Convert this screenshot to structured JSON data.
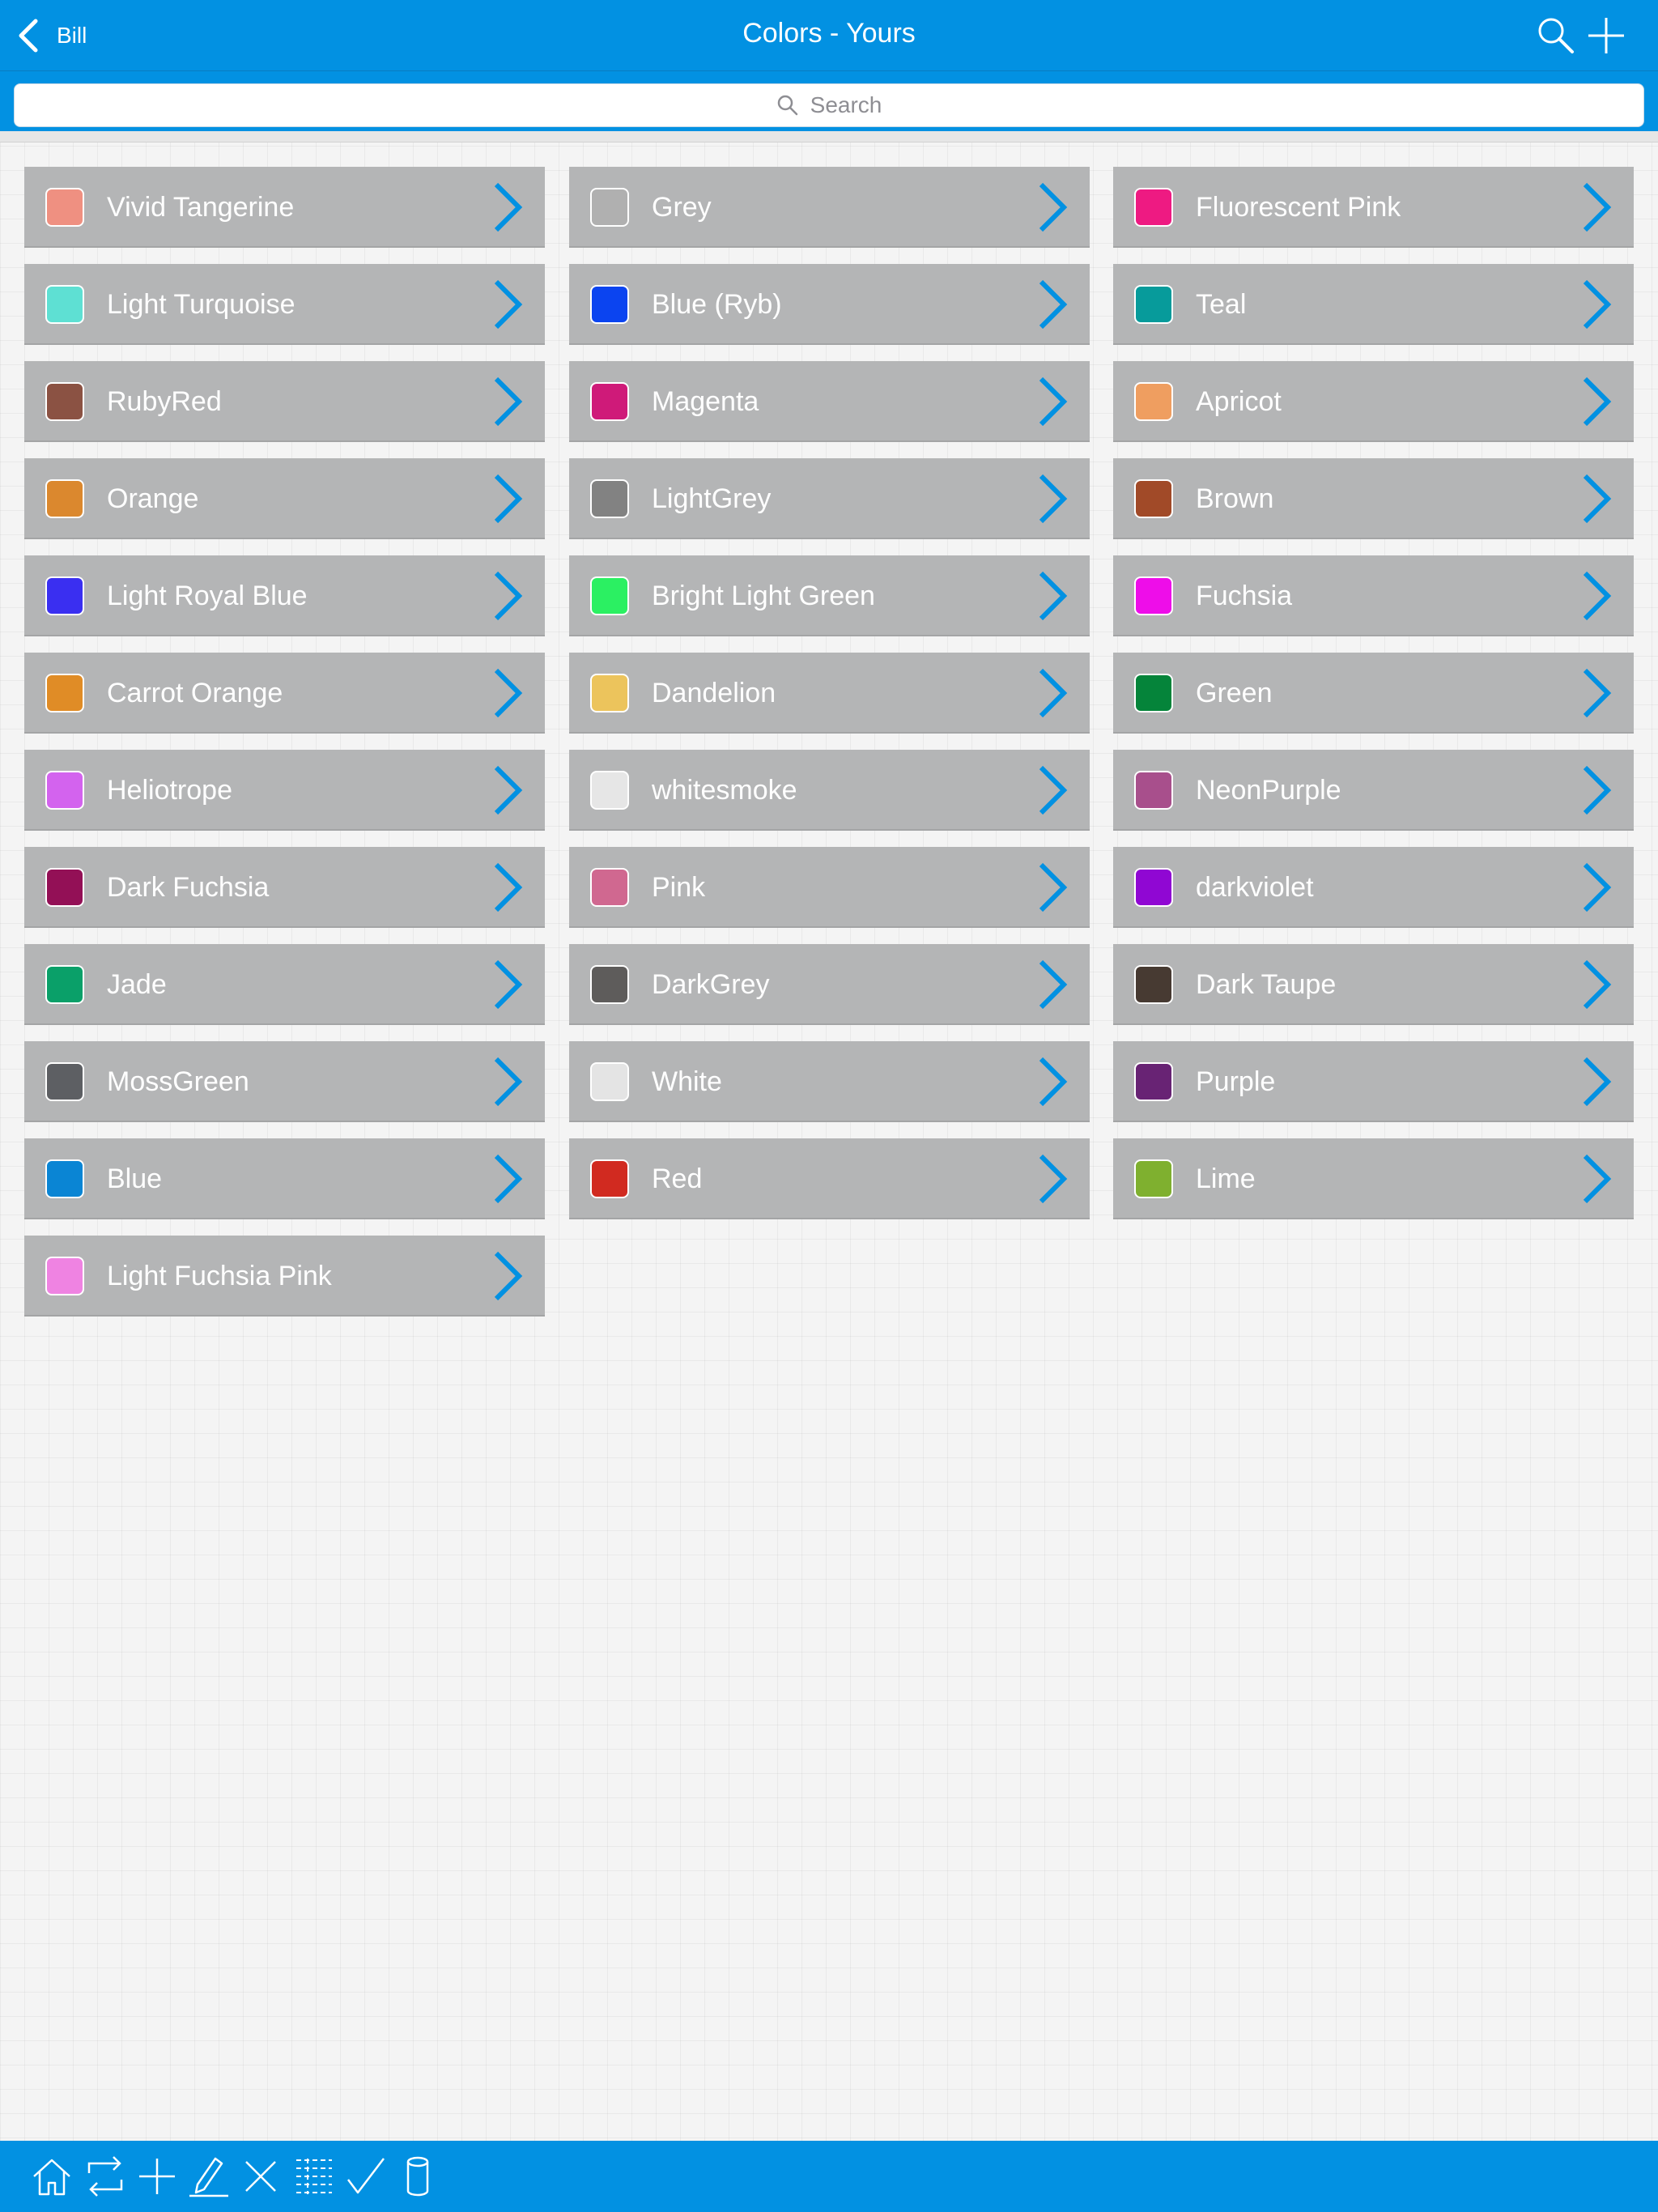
{
  "nav": {
    "back_label": "Bill",
    "title": "Colors - Yours"
  },
  "search": {
    "placeholder": "Search"
  },
  "accent_color": "#0291e2",
  "row_background": "#b4b5b6",
  "columns": [
    [
      {
        "label": "Vivid Tangerine",
        "color": "#ef9081"
      },
      {
        "label": "Light Turquoise",
        "color": "#5ee0d3"
      },
      {
        "label": "RubyRed",
        "color": "#8b5243"
      },
      {
        "label": "Orange",
        "color": "#db882e"
      },
      {
        "label": "Light Royal Blue",
        "color": "#3a2ff1"
      },
      {
        "label": "Carrot Orange",
        "color": "#e08c26"
      },
      {
        "label": "Heliotrope",
        "color": "#d363ee"
      },
      {
        "label": "Dark Fuchsia",
        "color": "#931056"
      },
      {
        "label": "Jade",
        "color": "#0aa069"
      },
      {
        "label": "MossGreen",
        "color": "#5d5f63"
      },
      {
        "label": "Blue",
        "color": "#0a85d4"
      },
      {
        "label": "Light Fuchsia Pink",
        "color": "#ef83e2"
      }
    ],
    [
      {
        "label": "Grey",
        "color": "#b0b0b0"
      },
      {
        "label": "Blue (Ryb)",
        "color": "#0b44f0"
      },
      {
        "label": "Magenta",
        "color": "#cf1a79"
      },
      {
        "label": "LightGrey",
        "color": "#828282"
      },
      {
        "label": "Bright Light Green",
        "color": "#2bf062"
      },
      {
        "label": "Dandelion",
        "color": "#ecc45c"
      },
      {
        "label": "whitesmoke",
        "color": "#e6e6e6"
      },
      {
        "label": "Pink",
        "color": "#d06890"
      },
      {
        "label": "DarkGrey",
        "color": "#5e5c5b"
      },
      {
        "label": "White",
        "color": "#e4e4e4"
      },
      {
        "label": "Red",
        "color": "#d12a20"
      }
    ],
    [
      {
        "label": "Fluorescent Pink",
        "color": "#ee1a82"
      },
      {
        "label": "Teal",
        "color": "#079b9b"
      },
      {
        "label": "Apricot",
        "color": "#ef9e60"
      },
      {
        "label": "Brown",
        "color": "#a14a28"
      },
      {
        "label": "Fuchsia",
        "color": "#ee0de9"
      },
      {
        "label": "Green",
        "color": "#05843a"
      },
      {
        "label": "NeonPurple",
        "color": "#a84f8c"
      },
      {
        "label": "darkviolet",
        "color": "#9007d3"
      },
      {
        "label": "Dark Taupe",
        "color": "#473a32"
      },
      {
        "label": "Purple",
        "color": "#682374"
      },
      {
        "label": "Lime",
        "color": "#7fb02f"
      }
    ]
  ],
  "toolbar": {
    "tools": [
      "home-icon",
      "sync-icon",
      "add-icon",
      "edit-icon",
      "delete-icon",
      "list-icon",
      "checkmark-icon",
      "database-icon"
    ]
  }
}
